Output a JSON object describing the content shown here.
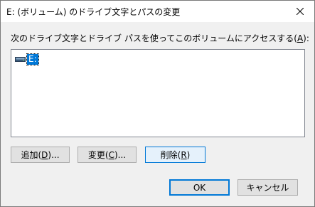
{
  "window": {
    "title": "E: (ボリューム) のドライブ文字とパスの変更",
    "close_glyph": "✕"
  },
  "prompt": {
    "text_before": "次のドライブ文字とドライブ パスを使ってこのボリュームにアクセスする(",
    "accel": "A",
    "text_after": "):"
  },
  "paths": {
    "items": [
      {
        "label": "E:",
        "icon": "drive-icon",
        "selected": true
      }
    ]
  },
  "actions": {
    "add": {
      "text": "追加(",
      "accel": "D",
      "suffix": ")..."
    },
    "change": {
      "text": "変更(",
      "accel": "C",
      "suffix": ")..."
    },
    "remove": {
      "text": "削除(",
      "accel": "R",
      "suffix": ")"
    }
  },
  "footer": {
    "ok": "OK",
    "cancel": "キャンセル"
  },
  "colors": {
    "accent": "#0078d7",
    "button_face": "#e1e1e1",
    "button_hover": "#e5f1fb",
    "list_border": "#828790"
  }
}
